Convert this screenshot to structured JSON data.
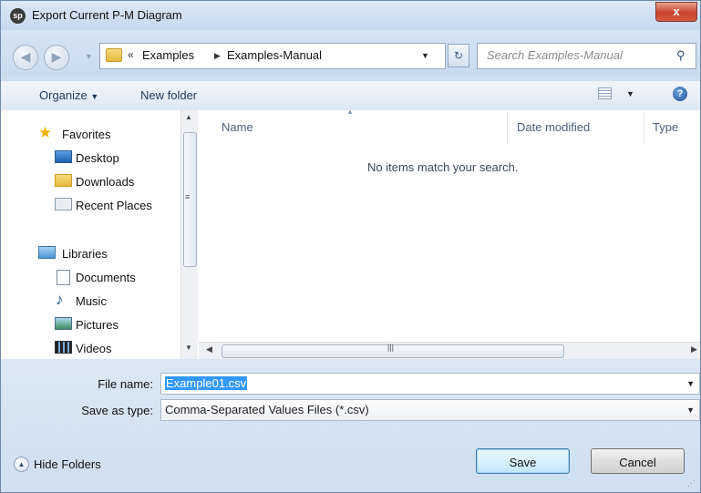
{
  "window": {
    "title": "Export Current P-M Diagram",
    "app_icon_label": "sp",
    "close_label": "x"
  },
  "navigation": {
    "breadcrumb": [
      "«",
      "Examples",
      "Examples-Manual"
    ],
    "search_placeholder": "Search Examples-Manual"
  },
  "toolbar": {
    "organize_label": "Organize",
    "new_folder_label": "New folder"
  },
  "sidebar": {
    "favorites": {
      "label": "Favorites",
      "items": [
        "Desktop",
        "Downloads",
        "Recent Places"
      ]
    },
    "libraries": {
      "label": "Libraries",
      "items": [
        "Documents",
        "Music",
        "Pictures",
        "Videos"
      ]
    }
  },
  "file_list": {
    "columns": [
      "Name",
      "Date modified",
      "Type"
    ],
    "empty_message": "No items match your search."
  },
  "form": {
    "file_name_label": "File name:",
    "file_name_value": "Example01.csv",
    "save_as_type_label": "Save as type:",
    "save_as_type_value": "Comma-Separated Values Files (*.csv)"
  },
  "footer": {
    "hide_folders_label": "Hide Folders",
    "save_label": "Save",
    "cancel_label": "Cancel"
  },
  "colors": {
    "accent": "#3399ff",
    "titlebar": "#c6d9ee",
    "close_button": "#c9442e"
  }
}
